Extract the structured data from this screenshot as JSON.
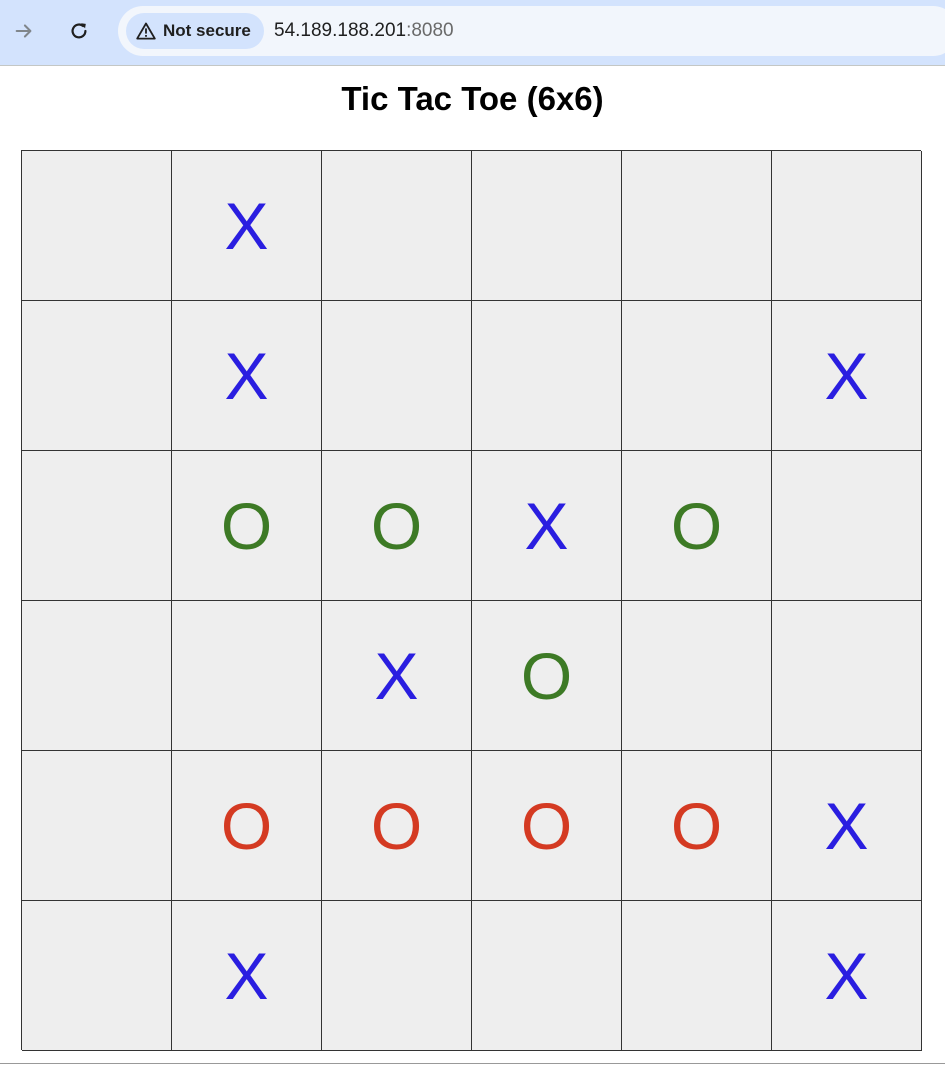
{
  "browser": {
    "security_label": "Not secure",
    "url_host": "54.189.188.201",
    "url_port": ":8080"
  },
  "page": {
    "title": "Tic Tac Toe (6x6)"
  },
  "colors": {
    "x": "#2a1ee0",
    "o_green": "#3d7a25",
    "o_red": "#d43a22"
  },
  "board": {
    "rows": [
      [
        "",
        "X",
        "",
        "",
        "",
        ""
      ],
      [
        "",
        "X",
        "",
        "",
        "",
        "X"
      ],
      [
        "",
        "O",
        "O",
        "X",
        "O",
        ""
      ],
      [
        "",
        "",
        "X",
        "O",
        "",
        ""
      ],
      [
        "",
        "O",
        "O",
        "O",
        "O",
        "X"
      ],
      [
        "",
        "X",
        "",
        "",
        "",
        "X"
      ]
    ],
    "o_colors": [
      [
        "",
        "",
        "",
        "",
        "",
        ""
      ],
      [
        "",
        "",
        "",
        "",
        "",
        ""
      ],
      [
        "",
        "green",
        "green",
        "",
        "green",
        ""
      ],
      [
        "",
        "",
        "",
        "green",
        "",
        ""
      ],
      [
        "",
        "red",
        "red",
        "red",
        "red",
        ""
      ],
      [
        "",
        "",
        "",
        "",
        "",
        ""
      ]
    ]
  }
}
